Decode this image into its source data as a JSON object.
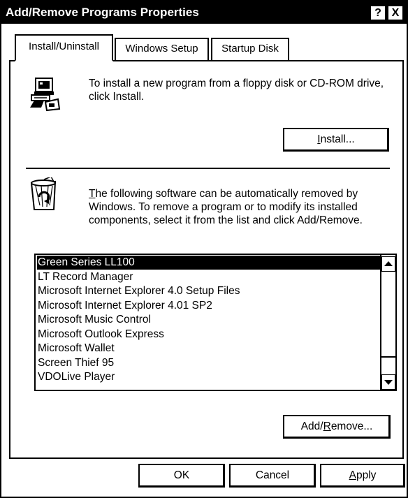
{
  "window": {
    "title": "Add/Remove Programs Properties",
    "help_label": "?",
    "close_label": "X"
  },
  "tabs": [
    {
      "label": "Install/Uninstall",
      "active": true
    },
    {
      "label": "Windows Setup",
      "active": false
    },
    {
      "label": "Startup Disk",
      "active": false
    }
  ],
  "install": {
    "icon": "computer-floppy-icon",
    "text": "To install a new program from a floppy disk or CD-ROM drive, click Install.",
    "button_prefix": "",
    "button_mnemonic": "I",
    "button_rest": "nstall..."
  },
  "uninstall": {
    "icon": "recycle-bin-icon",
    "text_mnemonic": "T",
    "text_rest": "he following software can be automatically removed by Windows. To remove a program or to modify its installed components, select it from the list and click Add/Remove.",
    "items": [
      "Green Series LL100",
      "LT Record Manager",
      "Microsoft Internet Explorer 4.0 Setup Files",
      "Microsoft Internet Explorer 4.01 SP2",
      "Microsoft Music Control",
      "Microsoft Outlook Express",
      "Microsoft Wallet",
      "Screen Thief 95",
      "VDOLive Player"
    ],
    "selected_index": 0,
    "button_prefix": "Add/",
    "button_mnemonic": "R",
    "button_rest": "emove..."
  },
  "footer": {
    "ok_label": "OK",
    "cancel_label": "Cancel",
    "apply_mnemonic": "A",
    "apply_rest": "pply"
  }
}
